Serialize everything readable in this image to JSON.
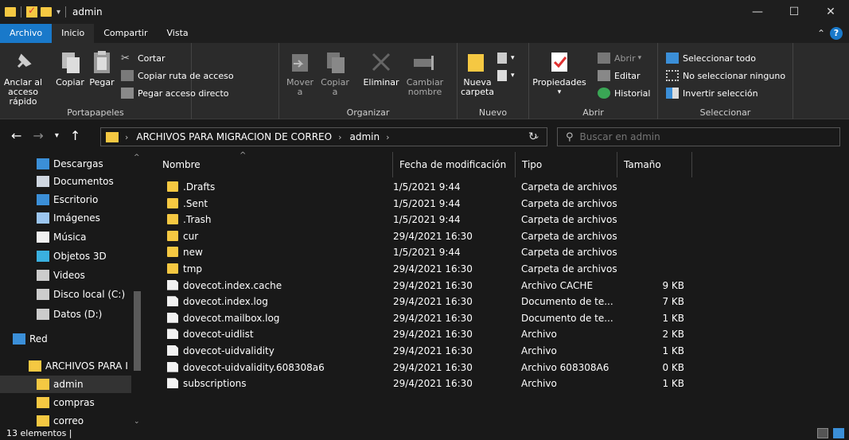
{
  "window": {
    "title": "admin",
    "minimize": "—",
    "maximize": "☐",
    "close": "✕"
  },
  "tabs": [
    "Archivo",
    "Inicio",
    "Compartir",
    "Vista"
  ],
  "ribbon": {
    "portapapeles": {
      "label": "Portapapeles",
      "anclar": "Anclar al acceso rápido",
      "copiar": "Copiar",
      "pegar": "Pegar",
      "cortar": "Cortar",
      "copiar_ruta": "Copiar ruta de acceso",
      "pegar_acceso": "Pegar acceso directo"
    },
    "organizar": {
      "label": "Organizar",
      "mover": "Mover a",
      "copiar": "Copiar a",
      "eliminar": "Eliminar",
      "cambiar_nombre": "Cambiar nombre"
    },
    "nuevo": {
      "label": "Nuevo",
      "nueva_carpeta": "Nueva carpeta"
    },
    "abrir": {
      "label": "Abrir",
      "propiedades": "Propiedades",
      "abrir": "Abrir",
      "editar": "Editar",
      "historial": "Historial"
    },
    "seleccionar": {
      "label": "Seleccionar",
      "todo": "Seleccionar todo",
      "ninguno": "No seleccionar ninguno",
      "invertir": "Invertir selección"
    }
  },
  "address": {
    "crumb1": "ARCHIVOS PARA MIGRACION DE CORREO",
    "crumb2": "admin",
    "search_placeholder": "Buscar en admin"
  },
  "nav": [
    {
      "label": "Descargas",
      "icon": "download-icon"
    },
    {
      "label": "Documentos",
      "icon": "documents-icon"
    },
    {
      "label": "Escritorio",
      "icon": "desktop-icon"
    },
    {
      "label": "Imágenes",
      "icon": "pictures-icon"
    },
    {
      "label": "Música",
      "icon": "music-icon"
    },
    {
      "label": "Objetos 3D",
      "icon": "objects3d-icon"
    },
    {
      "label": "Videos",
      "icon": "videos-icon"
    },
    {
      "label": "Disco local (C:)",
      "icon": "drive-icon"
    },
    {
      "label": "Datos (D:)",
      "icon": "drive-icon"
    },
    {
      "label": "Red",
      "icon": "network-icon"
    },
    {
      "label": "ARCHIVOS PARA I",
      "icon": "folder-icon"
    },
    {
      "label": "admin",
      "icon": "folder-icon"
    },
    {
      "label": "compras",
      "icon": "folder-icon"
    },
    {
      "label": "correo",
      "icon": "folder-icon"
    }
  ],
  "columns": {
    "name": "Nombre",
    "date": "Fecha de modificación",
    "type": "Tipo",
    "size": "Tamaño"
  },
  "files": [
    {
      "name": ".Drafts",
      "date": "1/5/2021 9:44",
      "type": "Carpeta de archivos",
      "size": "",
      "kind": "folder"
    },
    {
      "name": ".Sent",
      "date": "1/5/2021 9:44",
      "type": "Carpeta de archivos",
      "size": "",
      "kind": "folder"
    },
    {
      "name": ".Trash",
      "date": "1/5/2021 9:44",
      "type": "Carpeta de archivos",
      "size": "",
      "kind": "folder"
    },
    {
      "name": "cur",
      "date": "29/4/2021 16:30",
      "type": "Carpeta de archivos",
      "size": "",
      "kind": "folder"
    },
    {
      "name": "new",
      "date": "1/5/2021 9:44",
      "type": "Carpeta de archivos",
      "size": "",
      "kind": "folder"
    },
    {
      "name": "tmp",
      "date": "29/4/2021 16:30",
      "type": "Carpeta de archivos",
      "size": "",
      "kind": "folder"
    },
    {
      "name": "dovecot.index.cache",
      "date": "29/4/2021 16:30",
      "type": "Archivo CACHE",
      "size": "9 KB",
      "kind": "file"
    },
    {
      "name": "dovecot.index.log",
      "date": "29/4/2021 16:30",
      "type": "Documento de te...",
      "size": "7 KB",
      "kind": "file"
    },
    {
      "name": "dovecot.mailbox.log",
      "date": "29/4/2021 16:30",
      "type": "Documento de te...",
      "size": "1 KB",
      "kind": "file"
    },
    {
      "name": "dovecot-uidlist",
      "date": "29/4/2021 16:30",
      "type": "Archivo",
      "size": "2 KB",
      "kind": "file"
    },
    {
      "name": "dovecot-uidvalidity",
      "date": "29/4/2021 16:30",
      "type": "Archivo",
      "size": "1 KB",
      "kind": "file"
    },
    {
      "name": "dovecot-uidvalidity.608308a6",
      "date": "29/4/2021 16:30",
      "type": "Archivo 608308A6",
      "size": "0 KB",
      "kind": "file"
    },
    {
      "name": "subscriptions",
      "date": "29/4/2021 16:30",
      "type": "Archivo",
      "size": "1 KB",
      "kind": "file"
    }
  ],
  "status": {
    "count": "13 elementos  |"
  }
}
